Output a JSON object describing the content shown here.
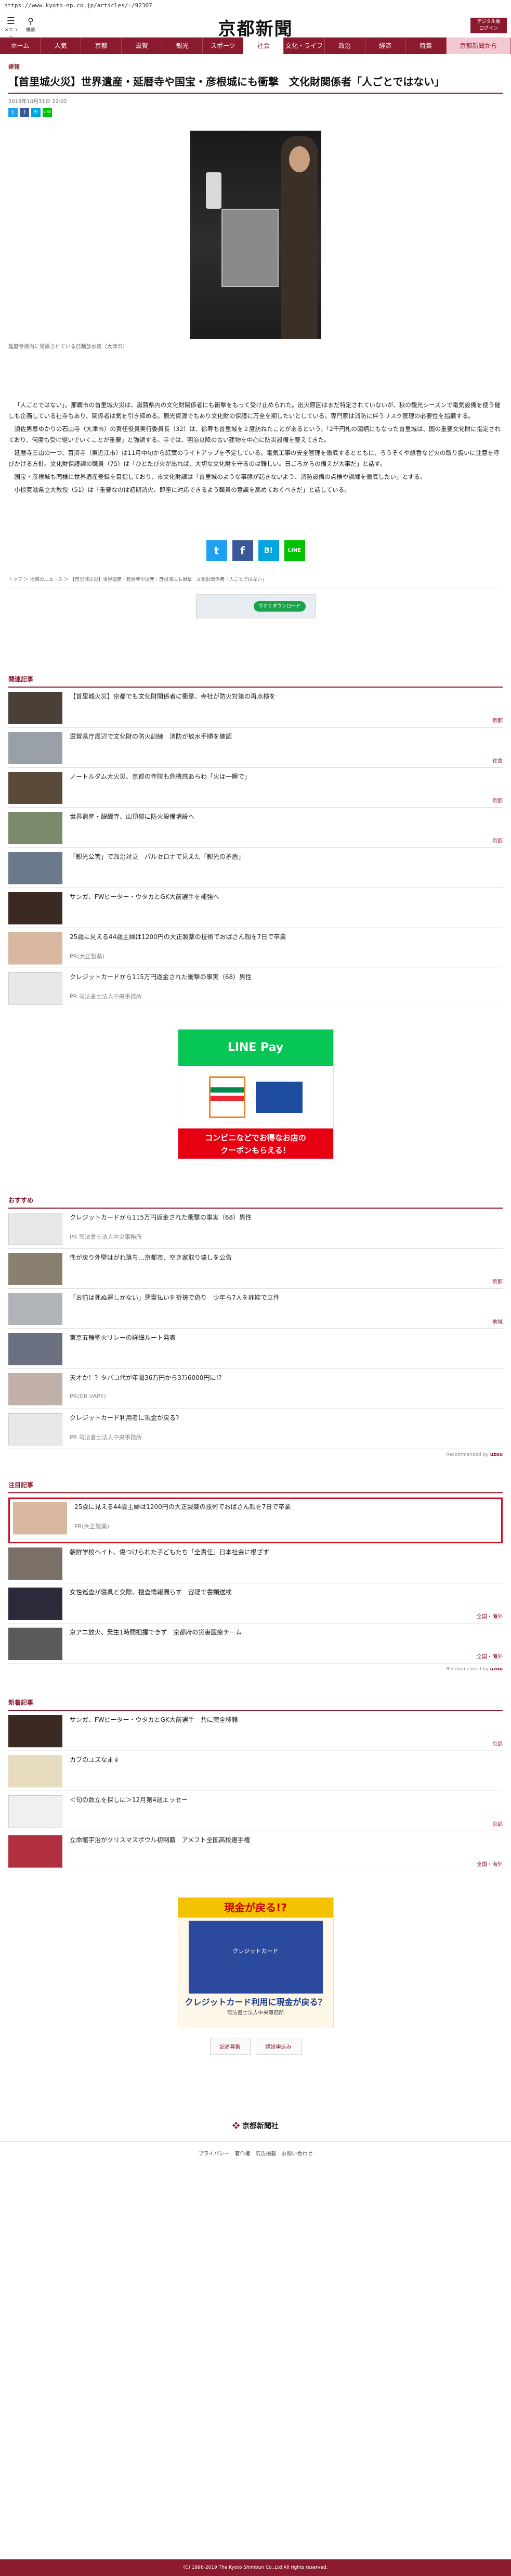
{
  "browser": {
    "url": "https://www.kyoto-np.co.jp/articles/-/92307"
  },
  "header": {
    "menu_label": "メニュー",
    "search_label": "検索",
    "logo": "京都新聞",
    "digital_label": "デジタル版\nログイン"
  },
  "nav": [
    "ホーム",
    "人気",
    "京都",
    "滋賀",
    "観光",
    "スポーツ",
    "社会",
    "文化・ライフ",
    "政治",
    "経済",
    "特集",
    "京都新聞から"
  ],
  "article": {
    "category": "速報",
    "title": "【首里城火災】世界遺産・延暦寺や国宝・彦根城にも衝撃　文化財関係者「人ごとではない」",
    "date": "2019年10月31日 22:02",
    "caption": "延暦寺境内に常設されている自動放水銃（大津市）",
    "paragraphs": [
      "「人ごとではない」。那覇市の首里城火災は、滋賀県内の文化財関係者にも衝撃をもって受け止められた。出火原因はまだ特定されていないが、秋の観光シーズンで電気設備を使う催しも企画している社寺もあり、関係者は気を引き締める。観光資源でもあり文化財の保護に万全を期したいとしている。専門家は消防に伴うリスク管理の必要性を指摘する。",
      "須佐男尊ゆかりの石山寺（大津市）の責任役員実行委員長（32）は、徐寿も首里城を２度訪ねたことがあるという。「2千円札の図柄にもなった首里城は、国の重要文化財に指定されており、何度も受け継いでいくことが重要」と強調する。寺では、明治以降の古い建物を中心に防災設備を整えてきた。",
      "延暦寺三山の一つ、百済寺（東近江市）は11月中旬から紅葉のライトアップを予定している。電気工事の安全管理を徹底するとともに、ろうそくや線香など火の取り扱いに注意を呼びかける方針。文化財保護課の職員（75）は「ひとたび火が出れば、大切な文化財を守るのは難しい。日ごろからの備えが大事だ」と話す。",
      "国宝・彦根城も同様に世界遺産登録を目指しており、市文化財課は「首里城のような事態が起きないよう、消防設備の点検や訓練を徹底したい」とする。",
      "小椋寛滋県立大教授（51）は「重要なのは初期消火。即座に対応できるよう職員の意識を高めておくべきだ」と話している。"
    ]
  },
  "share": {
    "twitter": "t",
    "facebook": "f",
    "hatena": "B!",
    "line": "LINE"
  },
  "breadcrumb": "トップ ＞ 地域のニュース ＞ 【首里城火災】世界遺産・延暦寺や国宝・彦根城にも衝撃　文化財関係者「人ごとではない」",
  "breadcrumb_ad": "今すぐダウンロード",
  "related": {
    "heading": "関連記事",
    "items": [
      {
        "title": "【首里城火災】京都でも文化財関係者に衝撃、寺社が防火対策の再点検を",
        "tag": "京都"
      },
      {
        "title": "滋賀県庁周辺で文化財の防火訓練　消防が放水手順を確認",
        "tag": "社会"
      },
      {
        "title": "ノートルダム大火災、京都の寺院も危機感あらわ「火は一瞬で」",
        "tag": "京都"
      },
      {
        "title": "世界遺産・醍醐寺、山頂部に防火設備増設へ",
        "tag": "京都"
      },
      {
        "title": "「観光公害」で政治対立　パルセロナで見えた「観光の矛盾」",
        "tag": ""
      },
      {
        "title": "サンガ、FWピーター・ウタカとGK大前選手を補強へ",
        "tag": ""
      },
      {
        "title": "25歳に見える44歳主婦は1200円の大正製薬の技術でおばさん顔を7日で卒業",
        "sub": "PR(大正製薬)",
        "tag": ""
      },
      {
        "title": "クレジットカードから115万円返金された衝撃の事実（68）男性",
        "sub": "PR 司法書士法人中央事務所",
        "tag": ""
      }
    ]
  },
  "ad_line": {
    "top": "LINE Pay",
    "bottom": "コンビニなどでお得なお店の\nクーポンもらえる！"
  },
  "recommend": {
    "heading": "おすすめ",
    "items": [
      {
        "title": "クレジットカードから115万円返金された衝撃の事実（68）男性",
        "sub": "PR 司法書士法人中央事務所",
        "tag": ""
      },
      {
        "title": "性が戻り外壁はがれ落ち…京都市、空き家取り壊しを公告",
        "tag": "京都"
      },
      {
        "title": "「お前は死ぬ運しかない」悪霊払いを祈祷で偽り　少年ら7人を詐欺で立件",
        "tag": "地域"
      },
      {
        "title": "東京五輪聖火リレーの詳細ルート発表",
        "tag": ""
      },
      {
        "title": "天才か！？タバコ代が年間36万円から3万6000円に!?",
        "sub": "PR(DR.VAPE)",
        "tag": ""
      },
      {
        "title": "クレジットカード利用者に現金が戻る？",
        "sub": "PR 司法書士法人中央事務所",
        "tag": ""
      }
    ],
    "powered": "Recommended by"
  },
  "notable": {
    "heading": "注目記事",
    "highlight": {
      "title": "25歳に見える44歳主婦は1200円の大正製薬の技術でおばさん顔を7日で卒業",
      "sub": "PR(大正製薬)"
    },
    "items": [
      {
        "title": "朝鮮学校ヘイト、傷つけられた子どもたち「全責任」日本社会に根ざす",
        "tag": ""
      },
      {
        "title": "女性巡査が寝具と交際、捜査情報漏らす　容疑で書類送検",
        "tag": "全国・海外"
      },
      {
        "title": "京アニ放火、発生1時間把握できず　京都府の災害医療チーム",
        "tag": "全国・海外"
      }
    ],
    "powered": "Recommended by"
  },
  "newest": {
    "heading": "新着記事",
    "items": [
      {
        "title": "サンガ、FWピーター・ウタカとGK大前選手　共に完全移籍",
        "tag": "京都"
      },
      {
        "title": "カブのユズなます",
        "tag": ""
      },
      {
        "title": "＜句の数立を探しに＞12月第4週エッセー",
        "tag": "京都"
      },
      {
        "title": "立命館宇治がクリスマスボウル初制覇　アメフト全国高校選手権",
        "tag": "全国・海外"
      }
    ]
  },
  "foot_ad": {
    "head": "現金が戻る!?",
    "mid": "クレジットカード",
    "main": "クレジットカード利用に現金が戻る？",
    "sub": "司法書士法人中央事務所"
  },
  "bottom_links": [
    "記者募集",
    "購読申込み"
  ],
  "brand": "京都新聞社",
  "footer_links": "プライバシー　著作権　広告掲載　お問い合わせ",
  "copyright": "(C) 1996-2019 The Kyoto Shimbun Co.,Ltd All rights reserved."
}
